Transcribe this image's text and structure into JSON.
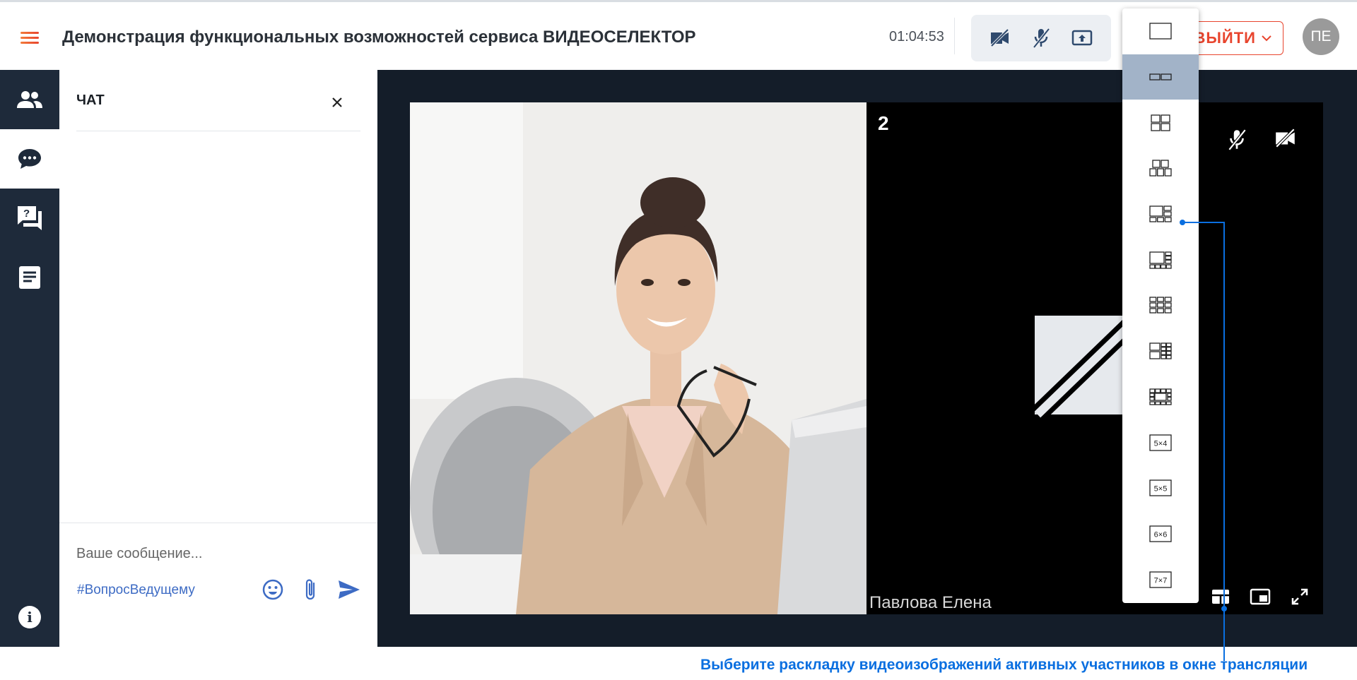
{
  "header": {
    "title": "Демонстрация функциональных возможностей сервиса ВИДЕОСЕЛЕКТОР",
    "timer": "01:04:53",
    "exit_label": "ВЫЙТИ",
    "avatar_initials": "ПЕ",
    "controls": [
      "camera-off-icon",
      "mic-off-icon",
      "screen-share-icon"
    ]
  },
  "sidebar": {
    "items": [
      {
        "icon": "participants-icon",
        "active": false
      },
      {
        "icon": "chat-icon",
        "active": true
      },
      {
        "icon": "questions-icon",
        "active": false
      },
      {
        "icon": "notes-icon",
        "active": false
      }
    ],
    "info_label": "i"
  },
  "chat": {
    "title": "ЧАТ",
    "placeholder": "Ваше сообщение...",
    "hashtag": "#ВопросВедущему"
  },
  "video": {
    "tile2_number": "2",
    "tile2_name": "Павлова Елена"
  },
  "layout_menu": {
    "selected_index": 1,
    "items": [
      {
        "icon": "layout-1x1-icon"
      },
      {
        "icon": "layout-2x1-icon"
      },
      {
        "icon": "layout-2x2-icon"
      },
      {
        "icon": "layout-3-2-icon"
      },
      {
        "icon": "layout-1plus5-icon"
      },
      {
        "icon": "layout-1plus7-icon"
      },
      {
        "icon": "layout-3x3-icon"
      },
      {
        "icon": "layout-2plus8-icon"
      },
      {
        "icon": "layout-1plus12-icon"
      },
      {
        "icon": "layout-5x4-icon",
        "label": "5×4"
      },
      {
        "icon": "layout-5x5-icon",
        "label": "5×5"
      },
      {
        "icon": "layout-6x6-icon",
        "label": "6×6"
      },
      {
        "icon": "layout-7x7-icon",
        "label": "7×7"
      }
    ]
  },
  "callout": {
    "text": "Выберите раскладку видеоизображений активных участников в окне трансляции"
  },
  "colors": {
    "accent": "#e8452e",
    "sidebar_bg": "#1e2a3a",
    "stage_bg": "#141d29",
    "callout": "#0a6fe0",
    "selected_layout": "#a2b3c8"
  }
}
